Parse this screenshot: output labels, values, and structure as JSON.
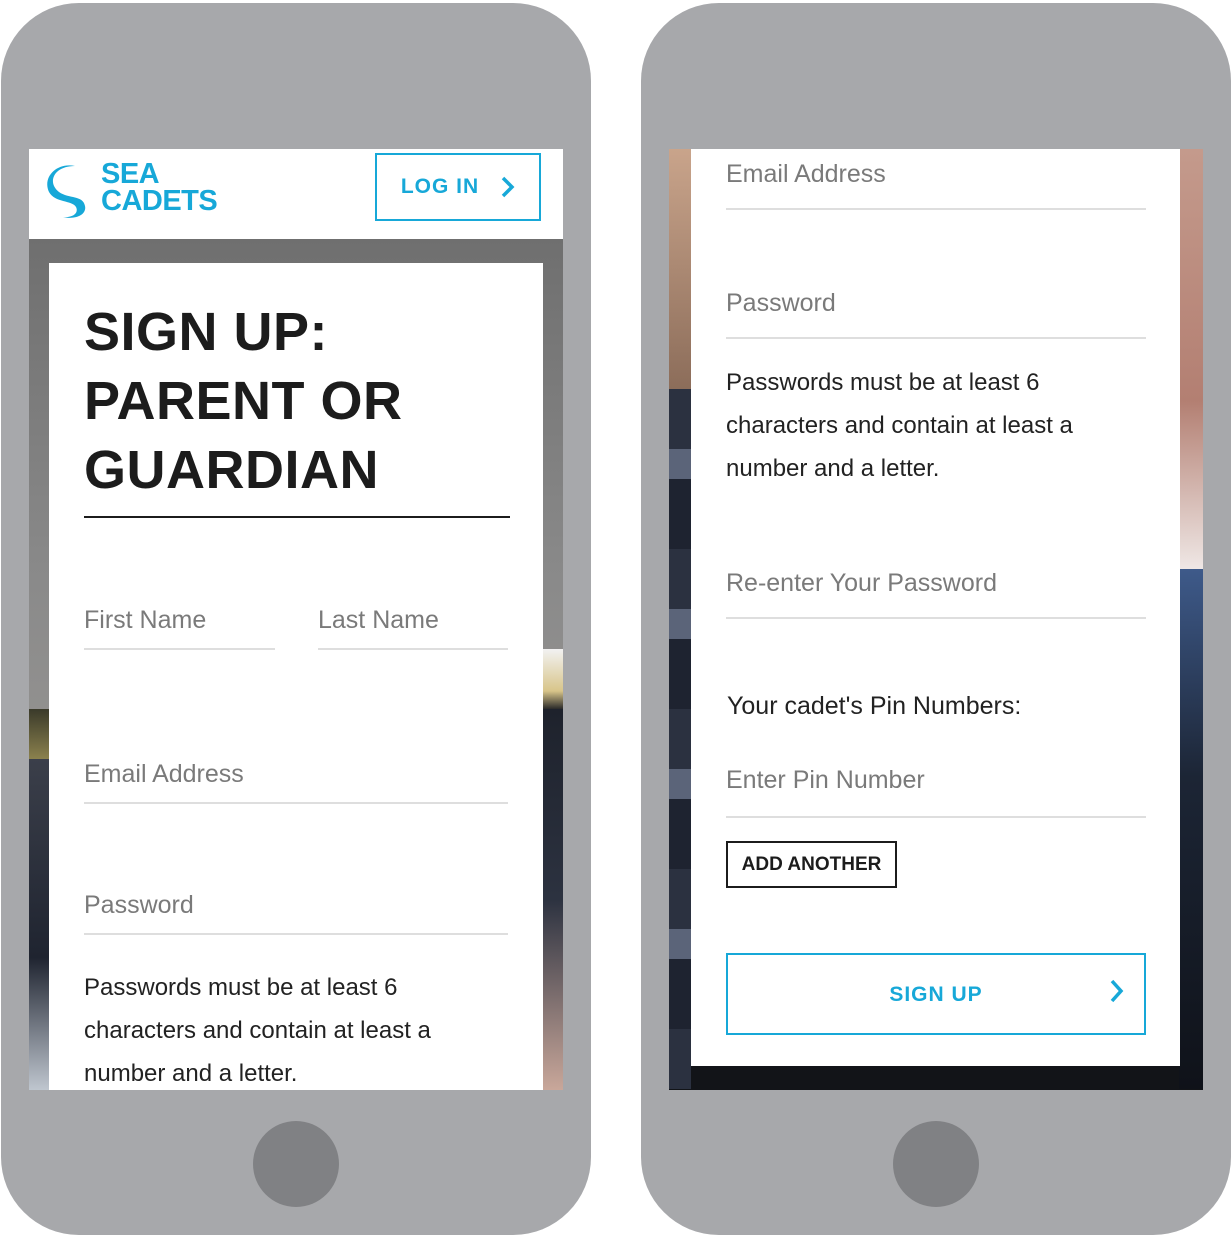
{
  "colors": {
    "brand": "#17a8d8",
    "phone_body": "#a7a8ab",
    "home_button": "#808184",
    "text_dark": "#1c1c1c",
    "placeholder": "#7a7a7a"
  },
  "left_screen": {
    "logo": {
      "line1": "SEA",
      "line2": "CADETS",
      "icon": "sea-cadets-wave-logo-icon"
    },
    "login_button": {
      "label": "LOG IN",
      "icon": "chevron-right-icon"
    },
    "title": {
      "line1": "SIGN UP:",
      "line2": "PARENT OR",
      "line3": "GUARDIAN"
    },
    "fields": {
      "first_name": "First Name",
      "last_name": "Last Name",
      "email": "Email Address",
      "password": "Password"
    },
    "password_hint": {
      "line1": "Passwords must be at least 6",
      "line2": "characters and contain at least a",
      "line3": "number and a letter."
    }
  },
  "right_screen": {
    "fields": {
      "email": "Email Address",
      "password": "Password",
      "reenter_password": "Re-enter Your Password",
      "pin": "Enter Pin Number"
    },
    "password_hint": {
      "line1": "Passwords must be at least 6",
      "line2": "characters and contain at least a",
      "line3": "number and a letter."
    },
    "pin_label": "Your cadet's Pin Numbers:",
    "add_another_button": "ADD ANOTHER",
    "signup_button": {
      "label": "SIGN UP",
      "icon": "chevron-right-icon"
    }
  }
}
